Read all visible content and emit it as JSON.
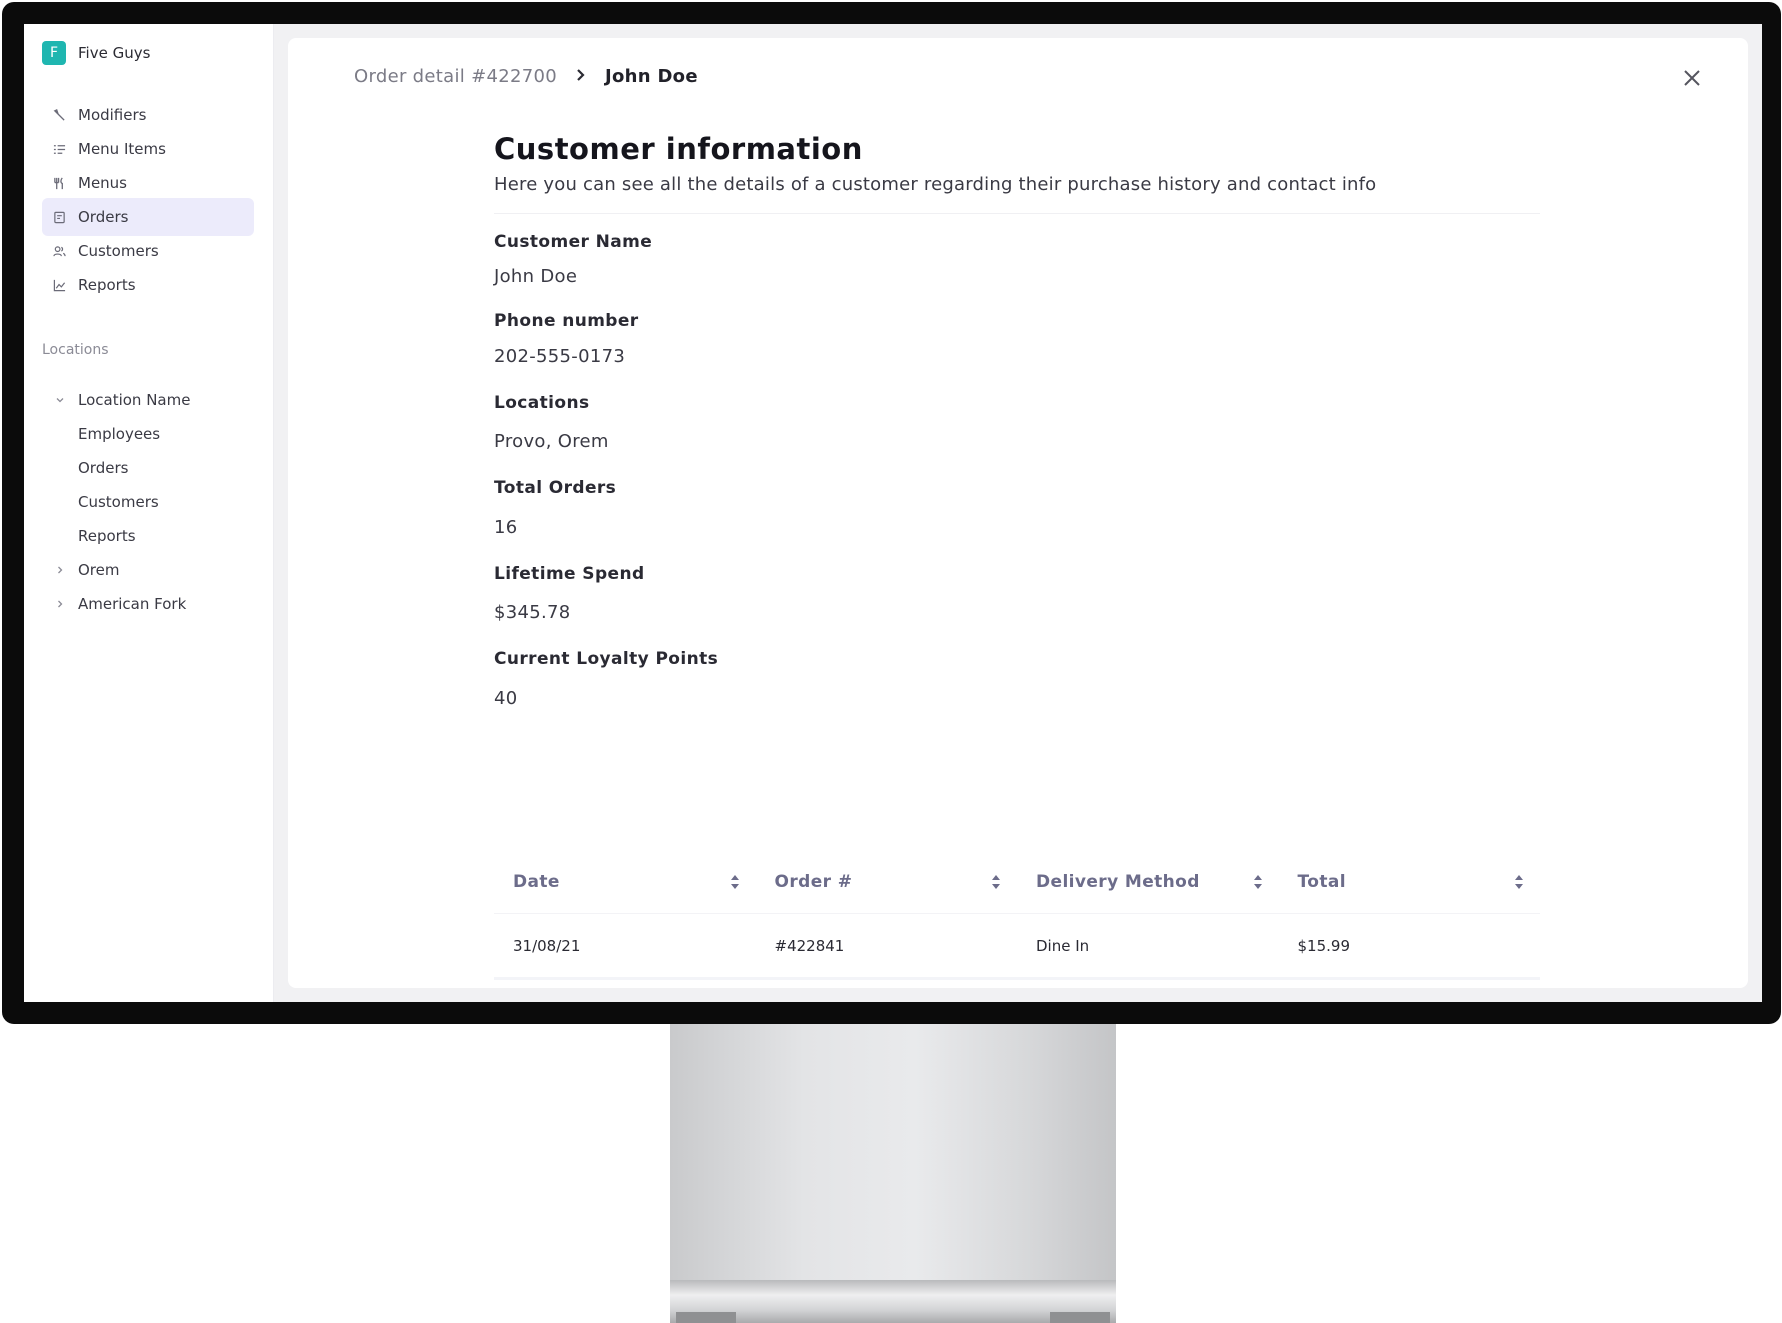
{
  "brand": {
    "initial": "F",
    "name": "Five Guys"
  },
  "sidebar": {
    "items": [
      {
        "label": "Modifiers",
        "icon": "wrench-icon"
      },
      {
        "label": "Menu Items",
        "icon": "list-icon"
      },
      {
        "label": "Menus",
        "icon": "utensils-icon"
      },
      {
        "label": "Orders",
        "icon": "receipt-icon",
        "active": true
      },
      {
        "label": "Customers",
        "icon": "users-icon"
      },
      {
        "label": "Reports",
        "icon": "chart-icon"
      }
    ],
    "section_label": "Locations",
    "locations": [
      {
        "label": "Location Name",
        "expanded": true,
        "children": [
          "Employees",
          "Orders",
          "Customers",
          "Reports"
        ]
      },
      {
        "label": "Orem",
        "expanded": false
      },
      {
        "label": "American Fork",
        "expanded": false
      }
    ]
  },
  "breadcrumb": {
    "parent": "Order detail #422700",
    "current": "John Doe"
  },
  "customer": {
    "title": "Customer information",
    "subtitle": "Here you can see all the details of a customer regarding their purchase history and contact info",
    "fields": [
      {
        "label": "Customer Name",
        "value": "John Doe"
      },
      {
        "label": "Phone number",
        "value": "202-555-0173"
      },
      {
        "label": "Locations",
        "value": "Provo, Orem"
      },
      {
        "label": "Total Orders",
        "value": "16"
      },
      {
        "label": "Lifetime Spend",
        "value": "$345.78"
      },
      {
        "label": "Current Loyalty Points",
        "value": "40"
      }
    ]
  },
  "orders_table": {
    "columns": [
      "Date",
      "Order #",
      "Delivery Method",
      "Total"
    ],
    "rows": [
      [
        "31/08/21",
        "#422841",
        "Dine In",
        "$15.99"
      ]
    ]
  },
  "colors": {
    "brand": "#1fb6b0",
    "active_nav": "#ecebfb",
    "table_header": "#6c6c8a"
  }
}
